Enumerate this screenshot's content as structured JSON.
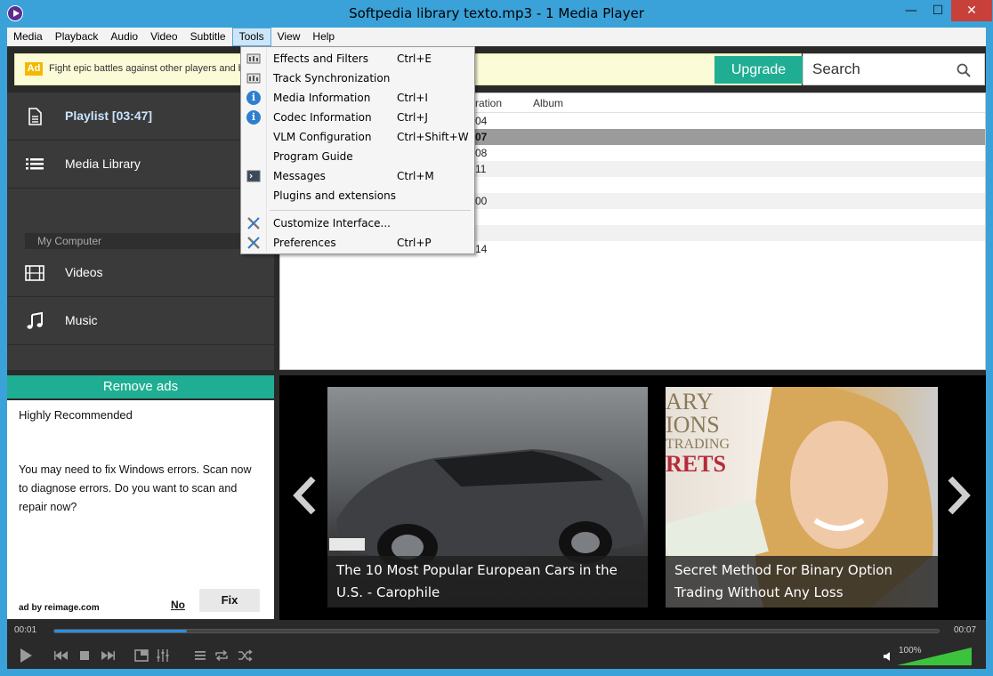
{
  "window": {
    "title": "Softpedia library texto.mp3 - 1 Media Player",
    "min_glyph": "—",
    "max_glyph": "☐",
    "close_glyph": "✕"
  },
  "menubar": {
    "items": [
      "Media",
      "Playback",
      "Audio",
      "Video",
      "Subtitle",
      "Tools",
      "View",
      "Help"
    ],
    "active": "Tools"
  },
  "ad_banner": {
    "badge": "Ad",
    "text": "Fight epic battles against other players and be",
    "upgrade_label": "Upgrade"
  },
  "search": {
    "placeholder": "Search"
  },
  "sidebar": {
    "playlist_label": "Playlist [03:47]",
    "media_library_label": "Media Library",
    "section_label": "My Computer",
    "videos_label": "Videos",
    "music_label": "Music"
  },
  "playlist": {
    "columns": [
      "ration",
      "Album"
    ],
    "rows": [
      "04",
      "07",
      "08",
      "11",
      "",
      "00",
      "",
      "",
      "14"
    ]
  },
  "remove_ads": {
    "label": "Remove ads",
    "heading": "Highly Recommended",
    "body": "You may need to fix Windows errors. Scan now to diagnose errors. Do you want to scan and repair now?",
    "by": "ad by reimage.com",
    "no_label": "No",
    "fix_label": "Fix"
  },
  "gallery": {
    "card1_caption": "The 10 Most Popular European Cars in the U.S. - Carophile",
    "card2_caption": "Secret Method For Binary Option Trading Without Any Loss",
    "card2_overlay_lines": [
      "ARY",
      "IONS",
      "TRADING",
      "RETS"
    ]
  },
  "transport": {
    "time_elapsed": "00:01",
    "time_total": "00:07",
    "progress_fraction": 0.15,
    "volume_label": "100%",
    "volume_fraction": 1.0
  },
  "tools_menu": {
    "items": [
      {
        "label": "Effects and Filters",
        "shortcut": "Ctrl+E",
        "icon": "equalizer-icon"
      },
      {
        "label": "Track Synchronization",
        "shortcut": "",
        "icon": "equalizer-icon"
      },
      {
        "label": "Media Information",
        "shortcut": "Ctrl+I",
        "icon": "info-icon"
      },
      {
        "label": "Codec Information",
        "shortcut": "Ctrl+J",
        "icon": "info-icon"
      },
      {
        "label": "VLM Configuration",
        "shortcut": "Ctrl+Shift+W",
        "icon": ""
      },
      {
        "label": "Program Guide",
        "shortcut": "",
        "icon": ""
      },
      {
        "label": "Messages",
        "shortcut": "Ctrl+M",
        "icon": "terminal-icon"
      },
      {
        "label": "Plugins and extensions",
        "shortcut": "",
        "icon": ""
      },
      {
        "label": "Customize Interface...",
        "shortcut": "",
        "icon": "tools-icon"
      },
      {
        "label": "Preferences",
        "shortcut": "Ctrl+P",
        "icon": "tools-icon"
      }
    ]
  },
  "colors": {
    "accent_teal": "#1fae93",
    "titlebar_blue": "#3aa2d8",
    "close_red": "#c7403a",
    "progress_blue": "#2a8de0",
    "volume_green": "#3cc23c"
  }
}
